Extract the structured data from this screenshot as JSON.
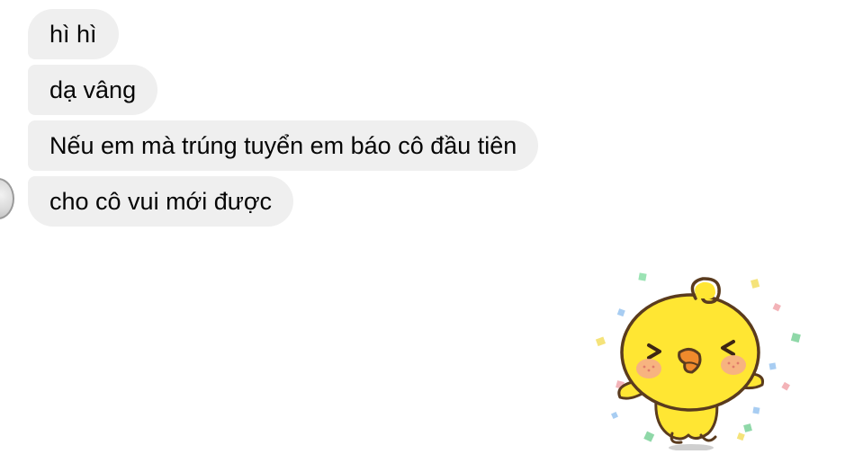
{
  "messages": [
    {
      "text": "hì hì"
    },
    {
      "text": "dạ vâng"
    },
    {
      "text": "Nếu em mà trúng tuyển em báo cô đầu tiên"
    },
    {
      "text": "cho cô vui mới được"
    }
  ],
  "avatar": {
    "icon": "profile-photo"
  },
  "sticker": {
    "icon": "yellow-chick-celebrating-sticker"
  },
  "colors": {
    "bubble_background": "#efefef",
    "text": "#050505",
    "sticker_yellow": "#ffe633",
    "sticker_outline": "#5a3b1e"
  }
}
